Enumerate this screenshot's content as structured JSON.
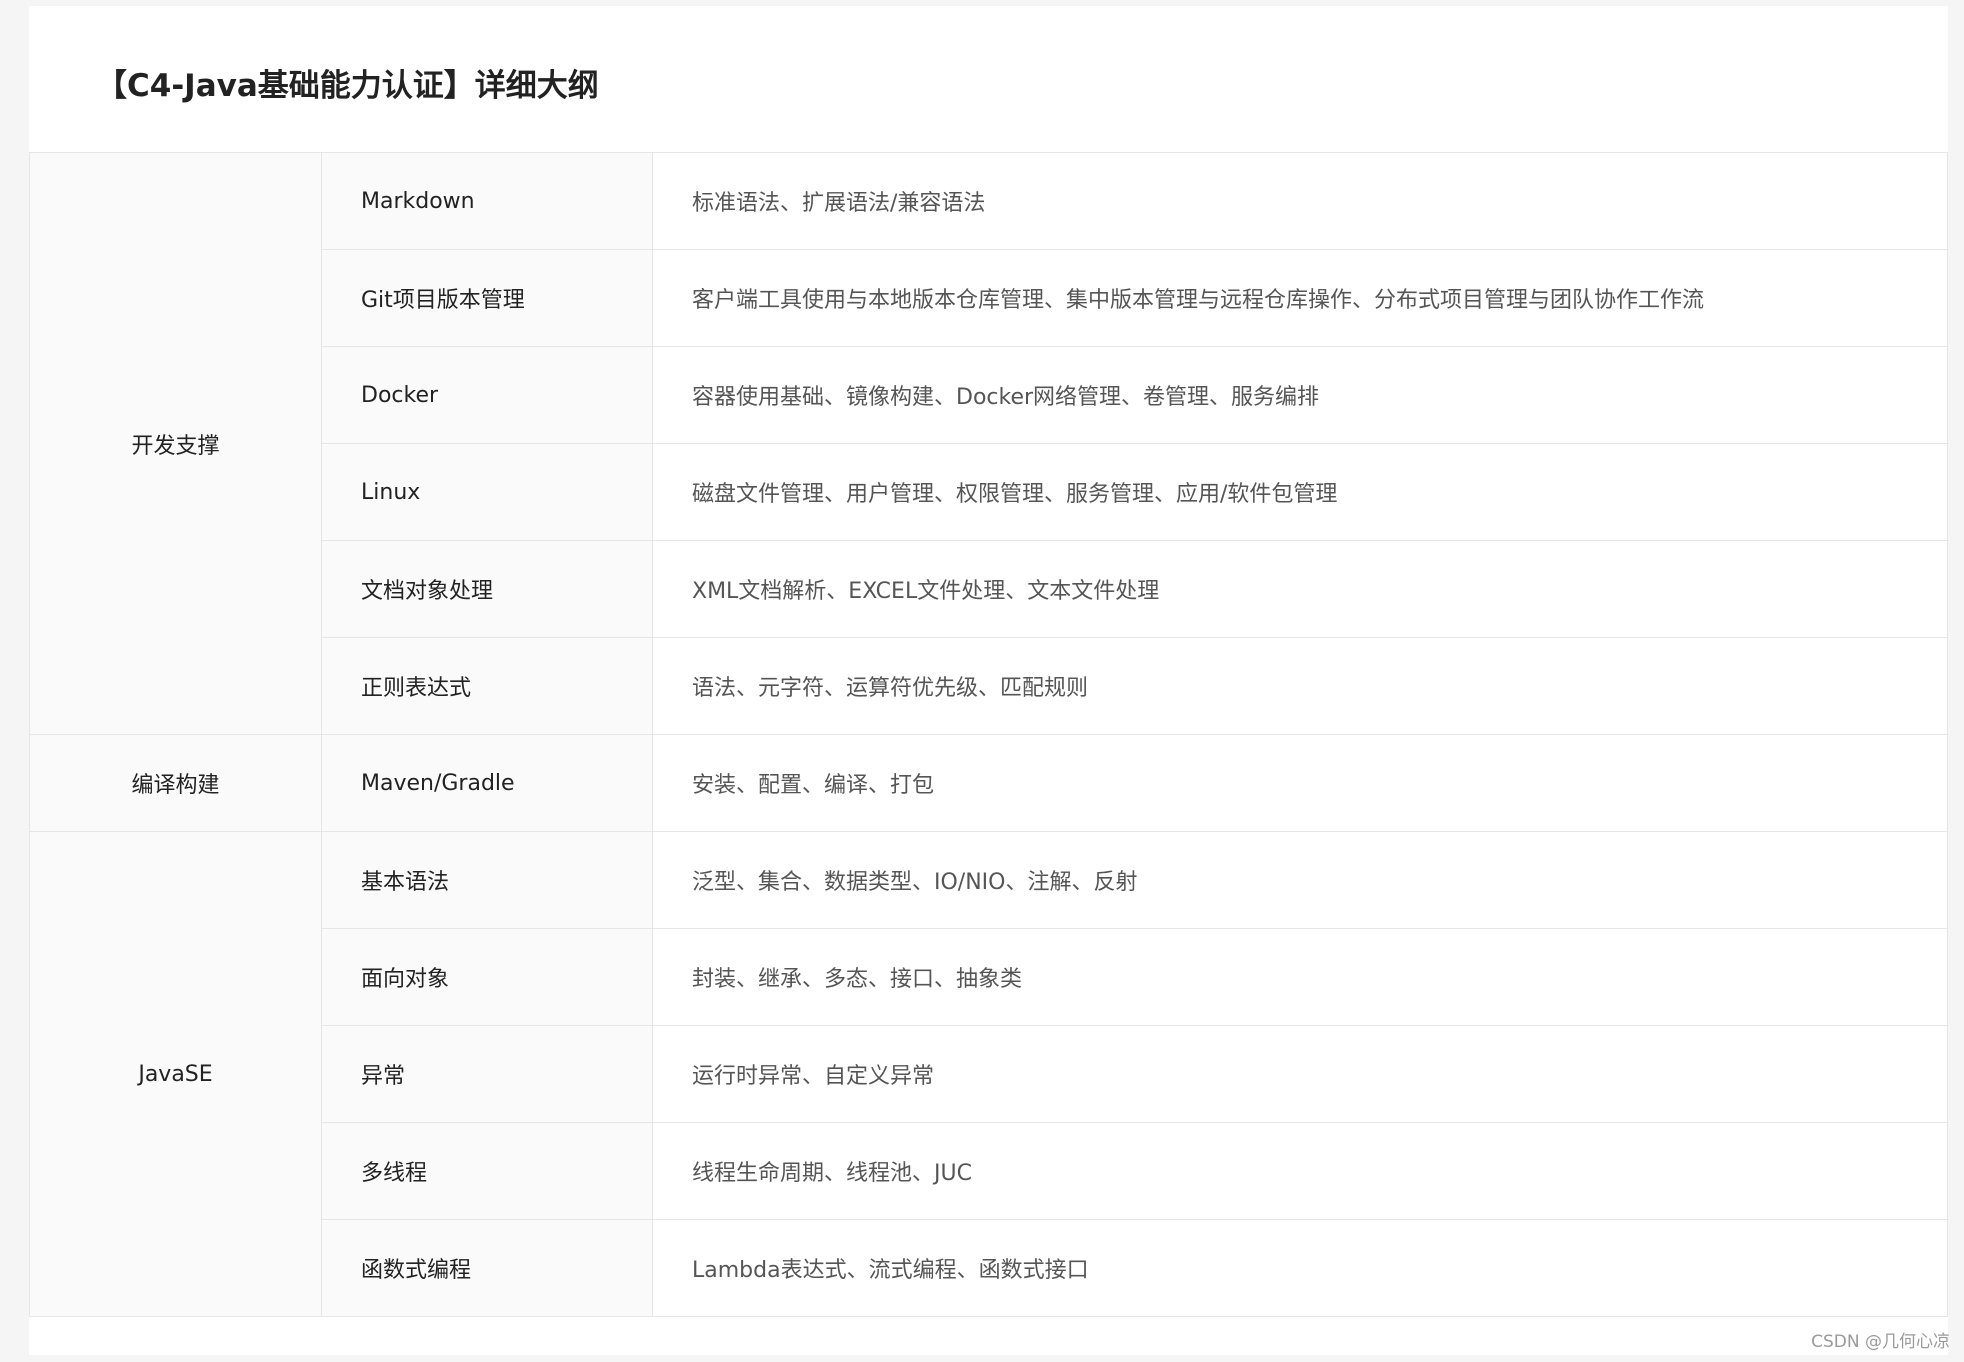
{
  "title": "【C4-Java基础能力认证】详细大纲",
  "sections": [
    {
      "category": "开发支撑",
      "items": [
        {
          "topic": "Markdown",
          "detail": "标准语法、扩展语法/兼容语法"
        },
        {
          "topic": "Git项目版本管理",
          "detail": "客户端工具使用与本地版本仓库管理、集中版本管理与远程仓库操作、分布式项目管理与团队协作工作流"
        },
        {
          "topic": "Docker",
          "detail": "容器使用基础、镜像构建、Docker网络管理、卷管理、服务编排"
        },
        {
          "topic": "Linux",
          "detail": "磁盘文件管理、用户管理、权限管理、服务管理、应用/软件包管理"
        },
        {
          "topic": "文档对象处理",
          "detail": "XML文档解析、EXCEL文件处理、文本文件处理"
        },
        {
          "topic": "正则表达式",
          "detail": "语法、元字符、运算符优先级、匹配规则"
        }
      ]
    },
    {
      "category": "编译构建",
      "items": [
        {
          "topic": "Maven/Gradle",
          "detail": "安装、配置、编译、打包"
        }
      ]
    },
    {
      "category": "JavaSE",
      "items": [
        {
          "topic": "基本语法",
          "detail": "泛型、集合、数据类型、IO/NIO、注解、反射"
        },
        {
          "topic": "面向对象",
          "detail": "封装、继承、多态、接口、抽象类"
        },
        {
          "topic": "异常",
          "detail": "运行时异常、自定义异常"
        },
        {
          "topic": "多线程",
          "detail": "线程生命周期、线程池、JUC"
        },
        {
          "topic": "函数式编程",
          "detail": "Lambda表达式、流式编程、函数式接口"
        }
      ]
    }
  ],
  "watermark": "CSDN @几何心凉"
}
